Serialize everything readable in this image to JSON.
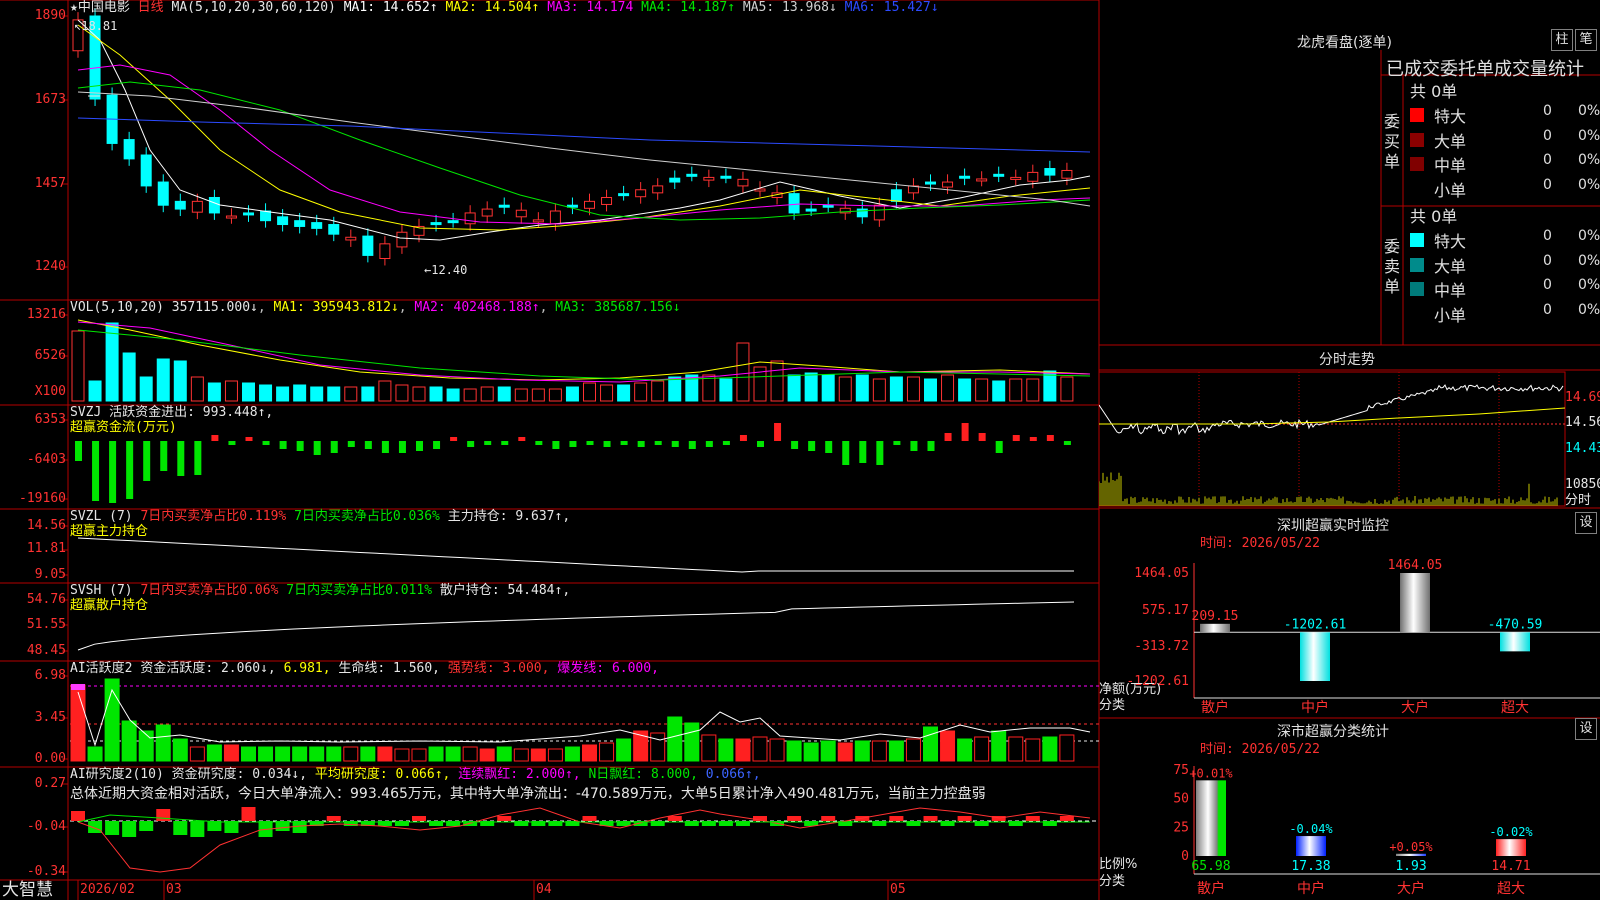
{
  "header": {
    "star": "★",
    "stock_name": "中国电影",
    "period": "日线",
    "ma_label": "MA(5,10,20,30,60,120)",
    "ma_items": [
      {
        "label": "MA1: 14.652↑",
        "color": "#ffffff"
      },
      {
        "label": "MA2: 14.504↑",
        "color": "#ffff00"
      },
      {
        "label": "MA3: 14.174",
        "color": "#ff00ff"
      },
      {
        "label": "MA4: 14.187↑",
        "color": "#00e600"
      },
      {
        "label": "MA5: 13.968↓",
        "color": "#d0d0d0"
      },
      {
        "label": "MA6: 15.427↓",
        "color": "#2c4bff"
      }
    ],
    "high_label": "18.81",
    "low_label": "12.40"
  },
  "price_axis": [
    "1890",
    "1673",
    "1457",
    "1240"
  ],
  "vol_panel": {
    "label": "VOL(5,10,20)",
    "value": "357115.000↓",
    "ma1": "MA1: 395943.812↓",
    "ma2": "MA2: 402468.188↑",
    "ma3": "MA3: 385687.156↓",
    "axis": [
      "13216",
      "6526",
      "X100"
    ]
  },
  "svzj_panel": {
    "label": "SVZJ",
    "text1": "活跃资金进出: 993.448↑,",
    "text2": "超赢资金流(万元)",
    "axis": [
      "6353",
      "-6403",
      "-19160"
    ]
  },
  "svzl_panel": {
    "label": "SVZL (7)",
    "text1": "7日内买卖净占比0.119%",
    "text2": "7日内买卖净占比0.036%",
    "text3": "主力持仓: 9.637↑,",
    "text4": "超赢主力持仓",
    "axis": [
      "14.56",
      "11.81",
      "9.05"
    ]
  },
  "svsh_panel": {
    "label": "SVSH (7)",
    "text1": "7日内买卖净占比0.06%",
    "text2": "7日内买卖净占比0.011%",
    "text3": "散户持仓: 54.484↑,",
    "text4": "超赢散户持仓",
    "axis": [
      "54.76",
      "51.55",
      "48.45"
    ]
  },
  "ai_active_panel": {
    "label": "AI活跃度2",
    "text1": "资金活跃度: 2.060↓,",
    "text2": "6.981,",
    "text3": "生命线: 1.560,",
    "text4": "强势线: 3.000,",
    "text5": "爆发线: 6.000,",
    "axis": [
      "6.98",
      "3.45",
      "0.00"
    ]
  },
  "ai_research_panel": {
    "label": "AI研究度2(10)",
    "text1": "资金研究度: 0.034↓,",
    "text2": "平均研究度: 0.066↑,",
    "text3": "连续飘红: 2.000↑,",
    "text4": "N日飘红: 8.000,",
    "text5": "0.066↑,",
    "summary": "总体近期大资金相对活跃，今日大单净流入：993.465万元，其中特大单净流出：-470.589万元，大单5日累计净入490.481万元，当前主力控盘弱",
    "axis": [
      "0.27",
      "-0.04",
      "-0.34"
    ]
  },
  "bottom_axis": {
    "brand": "大智慧",
    "dates": [
      "2026/02",
      "03",
      "04",
      "05"
    ]
  },
  "right_panel": {
    "lhb_title": "龙虎看盘(逐单)",
    "btn_zhu": "柱",
    "btn_bi": "笔",
    "stats_title": "已成交委托单成交量统计",
    "buy_side_label": [
      "委",
      "买",
      "单"
    ],
    "sell_side_label": [
      "委",
      "卖",
      "单"
    ],
    "buy_total": "共 0单",
    "sell_total": "共 0单",
    "buy_rows": [
      {
        "name": "特大",
        "count": "0",
        "pct": "0%",
        "color": "#ff0000"
      },
      {
        "name": "大单",
        "count": "0",
        "pct": "0%",
        "color": "#8b0000"
      },
      {
        "name": "中单",
        "count": "0",
        "pct": "0%",
        "color": "#800000"
      },
      {
        "name": "小单",
        "count": "0",
        "pct": "0%",
        "color": "#000000"
      }
    ],
    "sell_rows": [
      {
        "name": "特大",
        "count": "0",
        "pct": "0%",
        "color": "#00ffff"
      },
      {
        "name": "大单",
        "count": "0",
        "pct": "0%",
        "color": "#008b8b"
      },
      {
        "name": "中单",
        "count": "0",
        "pct": "0%",
        "color": "#007b7b"
      },
      {
        "name": "小单",
        "count": "0",
        "pct": "0%",
        "color": "#000000"
      }
    ],
    "intraday_title": "分时走势",
    "intraday_axis": [
      "14.69",
      "14.56",
      "14.43",
      "10850",
      "分时"
    ],
    "sz_monitor_title": "深圳超赢实时监控",
    "sz_time": "时间: 2026/05/22",
    "sz_btn": "设",
    "sz_axis": [
      "1464.05",
      "575.17",
      "-313.72",
      "-1202.61"
    ],
    "sz_ylabel": "净额(万元)",
    "sz_xlabel": "分类",
    "sz_categories": [
      "散户",
      "中户",
      "大户",
      "超大"
    ],
    "sz_value_labels": [
      "209.15",
      "-1202.61",
      "1464.05",
      "-470.59"
    ],
    "sh_stats_title": "深市超赢分类统计",
    "sh_time": "时间: 2026/05/22",
    "sh_btn": "设",
    "sh_axis": [
      "75",
      "50",
      "25",
      "0"
    ],
    "sh_ylabel": "比例%",
    "sh_xlabel": "分类",
    "sh_categories": [
      "散户",
      "中户",
      "大户",
      "超大"
    ],
    "sh_bottom_labels": [
      "65.98",
      "17.38",
      "1.93",
      "14.71"
    ],
    "sh_top_labels": [
      "+0.01%",
      "-0.04%",
      "+0.05%",
      "-0.02%"
    ]
  },
  "chart_data": [
    {
      "type": "bar",
      "title": "深圳超赢实时监控",
      "categories": [
        "散户",
        "中户",
        "大户",
        "超大"
      ],
      "values": [
        209.15,
        -1202.61,
        1464.05,
        -470.59
      ],
      "ylabel": "净额(万元)",
      "xlabel": "分类",
      "ylim": [
        -1202.61,
        1464.05
      ]
    },
    {
      "type": "bar",
      "title": "深市超赢分类统计",
      "categories": [
        "散户",
        "中户",
        "大户",
        "超大"
      ],
      "values": [
        65.98,
        17.38,
        1.93,
        14.71
      ],
      "ylabel": "比例%",
      "xlabel": "分类",
      "ylim": [
        0,
        75
      ]
    }
  ],
  "colors": {
    "up": "#ff3232",
    "down": "#00ffff",
    "grid": "#b40000",
    "ma1": "#ffffff",
    "ma2": "#ffff00",
    "ma3": "#ff00ff",
    "ma4": "#00e600",
    "ma5": "#d0d0d0",
    "ma6": "#2c4bff"
  }
}
